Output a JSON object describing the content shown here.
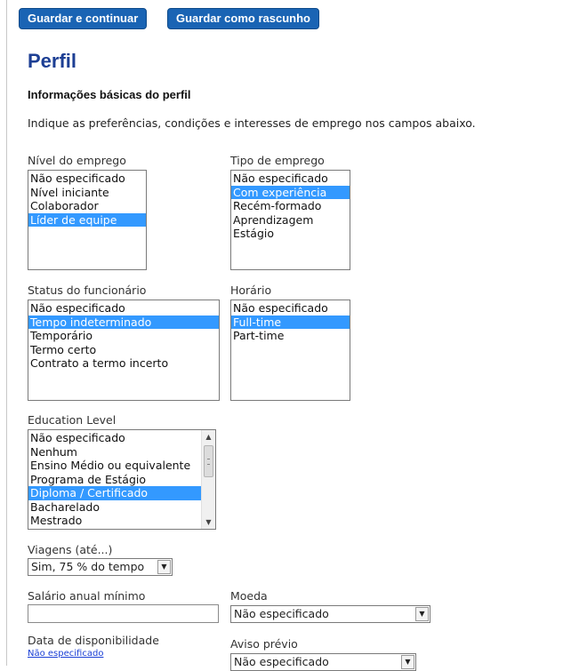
{
  "buttons": {
    "save_continue": "Guardar e continuar",
    "save_draft": "Guardar como rascunho"
  },
  "page": {
    "title": "Perfil",
    "subtitle": "Informações básicas do perfil",
    "intro": "Indique as preferências, condições e interesses de emprego nos campos abaixo."
  },
  "fields": {
    "job_level": {
      "label": "Nível do emprego",
      "options": [
        "Não especificado",
        "Nível iniciante",
        "Colaborador",
        "Líder de equipe"
      ],
      "selected": "Líder de equipe"
    },
    "job_type": {
      "label": "Tipo de emprego",
      "options": [
        "Não especificado",
        "Com experiência",
        "Recém-formado",
        "Aprendizagem",
        "Estágio"
      ],
      "selected": "Com experiência"
    },
    "employee_status": {
      "label": "Status do funcionário",
      "options": [
        "Não especificado",
        "Tempo indeterminado",
        "Temporário",
        "Termo certo",
        "Contrato a termo incerto"
      ],
      "selected": "Tempo indeterminado"
    },
    "schedule": {
      "label": "Horário",
      "options": [
        "Não especificado",
        "Full-time",
        "Part-time"
      ],
      "selected": "Full-time"
    },
    "education_level": {
      "label": "Education Level",
      "options": [
        "Não especificado",
        "Nenhum",
        "Ensino Médio ou equivalente",
        "Programa de Estágio",
        "Diploma / Certificado",
        "Bacharelado",
        "Mestrado"
      ],
      "selected": "Diploma / Certificado"
    },
    "travel": {
      "label": "Viagens (até...)",
      "value": "Sim, 75 % do tempo"
    },
    "min_salary": {
      "label": "Salário anual mínimo",
      "value": ""
    },
    "currency": {
      "label": "Moeda",
      "value": "Não especificado"
    },
    "availability_date": {
      "label": "Data de disponibilidade",
      "link": "Não especificado"
    },
    "notice_period": {
      "label": "Aviso prévio",
      "value": "Não especificado"
    }
  },
  "icons": {
    "dropdown": "chevron-down-icon",
    "scroll_up": "chevron-up-icon",
    "scroll_down": "chevron-down-icon"
  },
  "colors": {
    "button_bg": "#1a64b4",
    "title": "#1d3f94",
    "selection": "#3399ff",
    "link": "#1a3fd6"
  }
}
